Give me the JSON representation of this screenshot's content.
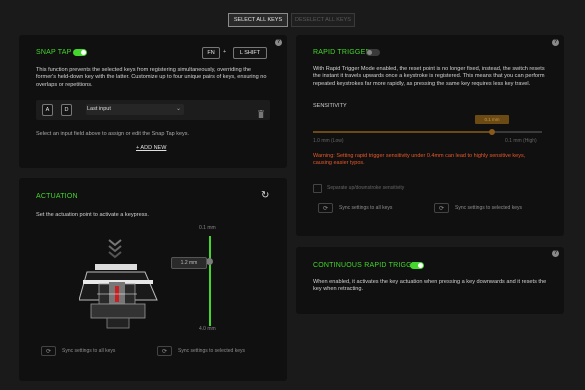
{
  "top": {
    "select_all": "SELECT ALL KEYS",
    "deselect_all": "DESELECT ALL KEYS"
  },
  "snap_tap": {
    "title": "SNAP TAP",
    "enabled": true,
    "key1": "FN",
    "plus": "+",
    "key2": "L SHIFT",
    "description": "This function prevents the selected keys from registering simultaneously, overriding the former's held-down key with the latter. Customize up to four unique pairs of keys, ensuring no overlaps or repetitions.",
    "pair": {
      "key_a": "A",
      "key_b": "D",
      "mode": "Last input"
    },
    "hint": "Select an input field above to assign or edit the Snap Tap keys.",
    "add_new": "+ ADD NEW"
  },
  "rapid_trigger": {
    "title": "RAPID TRIGGER",
    "enabled": false,
    "description": "With Rapid Trigger Mode enabled, the reset point is no longer fixed, instead, the switch resets the instant it travels upwards once a keystroke is registered. This means that you can perform repeated keystrokes far more rapidly, as pressing the same key requires less key travel.",
    "sensitivity_label": "SENSITIVITY",
    "sensitivity_value": "0.1 mm",
    "min_label": "1.0 mm (Low)",
    "max_label": "0.1 mm (High)",
    "warning": "Warning: Setting rapid trigger sensitivity under 0.4mm can lead to highly sensitive keys, causing easier typos.",
    "separate_label": "Separate up/downstroke sensitivity",
    "sync_all": "Sync settings to all keys",
    "sync_selected": "Sync settings to selected keys"
  },
  "actuation": {
    "title": "ACTUATION",
    "description": "Set the actuation point to activate a keypress.",
    "top_label": "0.1 mm",
    "bottom_label": "4.0 mm",
    "value_badge": "1.2 mm",
    "value_fraction": 0.28,
    "sync_all": "Sync settings to all keys",
    "sync_selected": "Sync settings to selected keys"
  },
  "continuous": {
    "title": "CONTINUOUS RAPID TRIGGER",
    "enabled": true,
    "description": "When enabled, it activates the key actuation when pressing a key downwards and it resets the key when retracting."
  },
  "colors": {
    "accent": "#44d62c",
    "warning": "#e8582a",
    "slider": "#9a6a1e"
  }
}
